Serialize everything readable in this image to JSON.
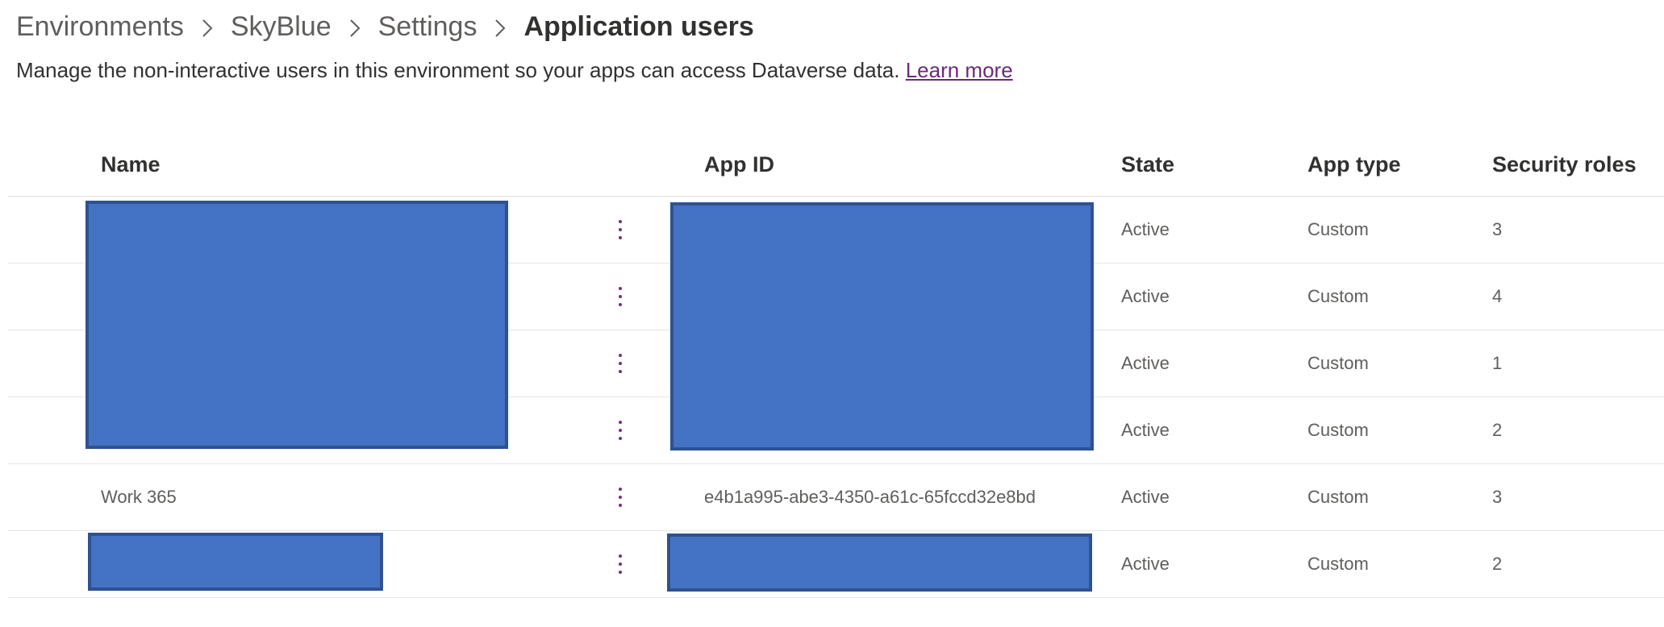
{
  "breadcrumb": {
    "items": [
      "Environments",
      "SkyBlue",
      "Settings"
    ],
    "current": "Application users"
  },
  "description": {
    "text": "Manage the non-interactive users in this environment so your apps can access Dataverse data. ",
    "link": "Learn more"
  },
  "table": {
    "columns": [
      "Name",
      "App ID",
      "State",
      "App type",
      "Security roles"
    ],
    "rows": [
      {
        "name": "",
        "app_id": "",
        "state": "Active",
        "app_type": "Custom",
        "security_roles": "3"
      },
      {
        "name": "",
        "app_id": "",
        "state": "Active",
        "app_type": "Custom",
        "security_roles": "4"
      },
      {
        "name": "",
        "app_id": "",
        "state": "Active",
        "app_type": "Custom",
        "security_roles": "1"
      },
      {
        "name": "",
        "app_id": "",
        "state": "Active",
        "app_type": "Custom",
        "security_roles": "2"
      },
      {
        "name": "Work 365",
        "app_id": "e4b1a995-abe3-4350-a61c-65fccd32e8bd",
        "state": "Active",
        "app_type": "Custom",
        "security_roles": "3"
      },
      {
        "name": "",
        "app_id": "",
        "state": "Active",
        "app_type": "Custom",
        "security_roles": "2"
      }
    ]
  },
  "icons": {
    "separator": "chevron-right-icon",
    "row_action": "more-vertical-icon"
  },
  "colors": {
    "link": "#6b2a7a",
    "more_icon": "#7a2a85",
    "redaction": "#4472c4"
  }
}
